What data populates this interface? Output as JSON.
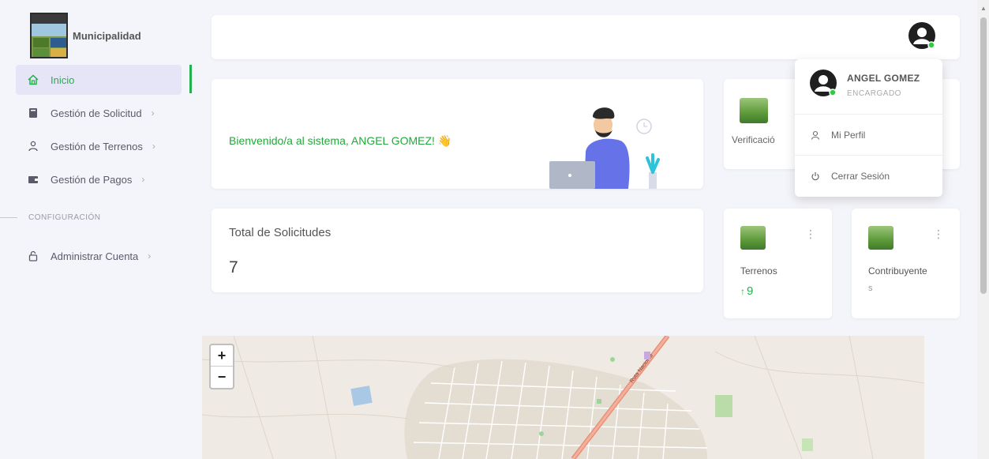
{
  "brand": {
    "name": "Municipalidad"
  },
  "sidebar": {
    "items": [
      {
        "label": "Inicio",
        "icon": "home-icon",
        "active": true
      },
      {
        "label": "Gestión de Solicitud",
        "icon": "book-icon",
        "chevron": "›"
      },
      {
        "label": "Gestión de Terrenos",
        "icon": "users-icon",
        "chevron": "›"
      },
      {
        "label": "Gestión de Pagos",
        "icon": "wallet-icon",
        "chevron": "›"
      }
    ],
    "section_label": "CONFIGURACIÓN",
    "config_items": [
      {
        "label": "Administrar Cuenta",
        "icon": "lock-icon",
        "chevron": "›"
      }
    ]
  },
  "welcome": {
    "text": "Bienvenido/a al sistema, ANGEL GOMEZ! 👋"
  },
  "verification_card": {
    "label": "Verificació"
  },
  "total_card": {
    "title": "Total de Solicitudes",
    "value": "7"
  },
  "terrenos_card": {
    "label": "Terrenos",
    "arrow": "↑",
    "value": "9"
  },
  "contrib_card": {
    "label": "Contribuyente",
    "sub": "s"
  },
  "map": {
    "zoom_in": "+",
    "zoom_out": "−",
    "road_label": "Ruta Nacional"
  },
  "dropdown": {
    "name": "ANGEL GOMEZ",
    "role": "ENCARGADO",
    "items": [
      {
        "label": "Mi Perfil",
        "icon": "user-icon"
      },
      {
        "label": "Cerrar Sesión",
        "icon": "power-icon"
      }
    ]
  },
  "colors": {
    "accent": "#22b14c",
    "active_bg": "#e6e4f7",
    "page_bg": "#f4f5fa"
  }
}
